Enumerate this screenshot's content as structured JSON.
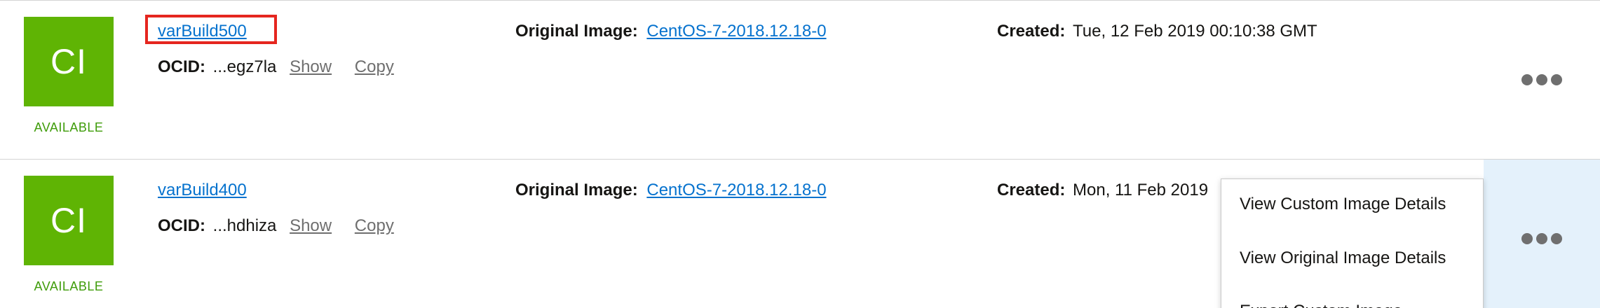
{
  "images": [
    {
      "tile_text": "CI",
      "status": "AVAILABLE",
      "name": "varBuild500",
      "ocid_label": "OCID:",
      "ocid_value": "...egz7la",
      "show_label": "Show",
      "copy_label": "Copy",
      "original_label": "Original Image:",
      "original_value": "CentOS-7-2018.12.18-0",
      "created_label": "Created:",
      "created_value": "Tue, 12 Feb 2019 00:10:38 GMT"
    },
    {
      "tile_text": "CI",
      "status": "AVAILABLE",
      "name": "varBuild400",
      "ocid_label": "OCID:",
      "ocid_value": "...hdhiza",
      "show_label": "Show",
      "copy_label": "Copy",
      "original_label": "Original Image:",
      "original_value": "CentOS-7-2018.12.18-0",
      "created_label": "Created:",
      "created_value": "Mon, 11 Feb 2019"
    }
  ],
  "actions_menu": {
    "items": [
      "View Custom Image Details",
      "View Original Image Details",
      "Export Custom Image"
    ]
  },
  "colors": {
    "tile": "#5fb404",
    "status": "#3f9c0a",
    "link": "#0572ce",
    "highlight": "#e5261f",
    "active_kebab": "#e4f1fb"
  },
  "icons": {
    "kebab": "more-actions-icon"
  }
}
